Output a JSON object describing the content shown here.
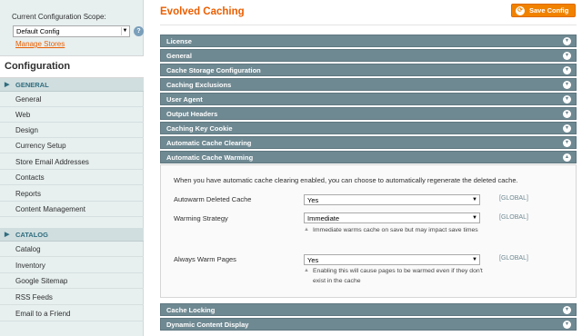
{
  "sidebar": {
    "scope_label": "Current Configuration Scope:",
    "scope_value": "Default Config",
    "manage_stores": "Manage Stores",
    "config_title": "Configuration",
    "sections": [
      {
        "title": "GENERAL",
        "items": [
          "General",
          "Web",
          "Design",
          "Currency Setup",
          "Store Email Addresses",
          "Contacts",
          "Reports",
          "Content Management"
        ]
      },
      {
        "title": "CATALOG",
        "items": [
          "Catalog",
          "Inventory",
          "Google Sitemap",
          "RSS Feeds",
          "Email to a Friend"
        ]
      }
    ]
  },
  "main": {
    "title": "Evolved Caching",
    "save_label": "Save Config",
    "collapsed_bars": [
      "License",
      "General",
      "Cache Storage Configuration",
      "Caching Exclusions",
      "User Agent",
      "Output Headers",
      "Caching Key Cookie",
      "Automatic Cache Clearing"
    ],
    "open_bar": "Automatic Cache Warming",
    "intro": "When you have automatic cache clearing enabled, you can choose to automatically regenerate the deleted cache.",
    "fields": [
      {
        "label": "Autowarm Deleted Cache",
        "value": "Yes",
        "scope": "[GLOBAL]",
        "hint": ""
      },
      {
        "label": "Warming Strategy",
        "value": "Immediate",
        "scope": "[GLOBAL]",
        "hint": "Immediate warms cache on save but may impact save times"
      },
      {
        "label": "Always Warm Pages",
        "value": "Yes",
        "scope": "[GLOBAL]",
        "hint": "Enabling this will cause pages to be warmed even if they don't exist in the cache"
      }
    ],
    "bottom_bars": [
      "Cache Locking",
      "Dynamic Content Display"
    ]
  },
  "colors": {
    "accent": "#eb5e00",
    "bar": "#6f8992",
    "section_text": "#2f6d7f"
  },
  "icons": {
    "help": "help-icon",
    "save": "save-icon",
    "toggle": "chevron-icon"
  }
}
